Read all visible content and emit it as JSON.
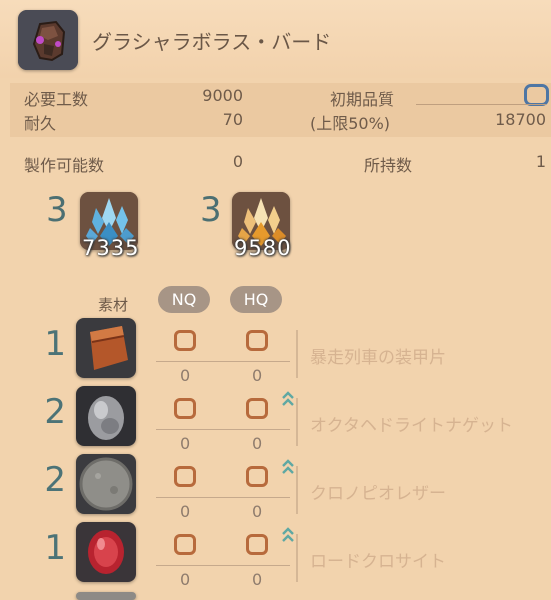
{
  "item": {
    "name": "グラシャラボラス・バード",
    "icon": "leather-cuirass-icon"
  },
  "stats": {
    "required_progress_label": "必要工数",
    "required_progress_value": "9000",
    "durability_label": "耐久",
    "durability_value": "70",
    "initial_quality_label": "初期品質",
    "cap_label": "(上限50%)",
    "quality_cap_value": "18700"
  },
  "craftable": {
    "label": "製作可能数",
    "value": "0",
    "owned_label": "所持数",
    "owned_value": "1"
  },
  "crystals": [
    {
      "count": "3",
      "stock": "7335",
      "icon": "ice-crystal-icon",
      "color": "#6ab7e0"
    },
    {
      "count": "3",
      "stock": "9580",
      "icon": "fire-crystal-icon",
      "color": "#f0b04a"
    }
  ],
  "materials_header": {
    "label": "素材",
    "nq": "NQ",
    "hq": "HQ"
  },
  "materials": [
    {
      "qty": "1",
      "name": "暴走列車の装甲片",
      "nq_count": "0",
      "hq_count": "0",
      "hq_available": false,
      "icon": "armor-plate-icon"
    },
    {
      "qty": "2",
      "name": "オクタヘドライトナゲット",
      "nq_count": "0",
      "hq_count": "0",
      "hq_available": true,
      "icon": "ore-nugget-icon"
    },
    {
      "qty": "2",
      "name": "クロノピオレザー",
      "nq_count": "0",
      "hq_count": "0",
      "hq_available": true,
      "icon": "leather-icon"
    },
    {
      "qty": "1",
      "name": "ロードクロサイト",
      "nq_count": "0",
      "hq_count": "0",
      "hq_available": true,
      "icon": "gemstone-icon"
    }
  ]
}
